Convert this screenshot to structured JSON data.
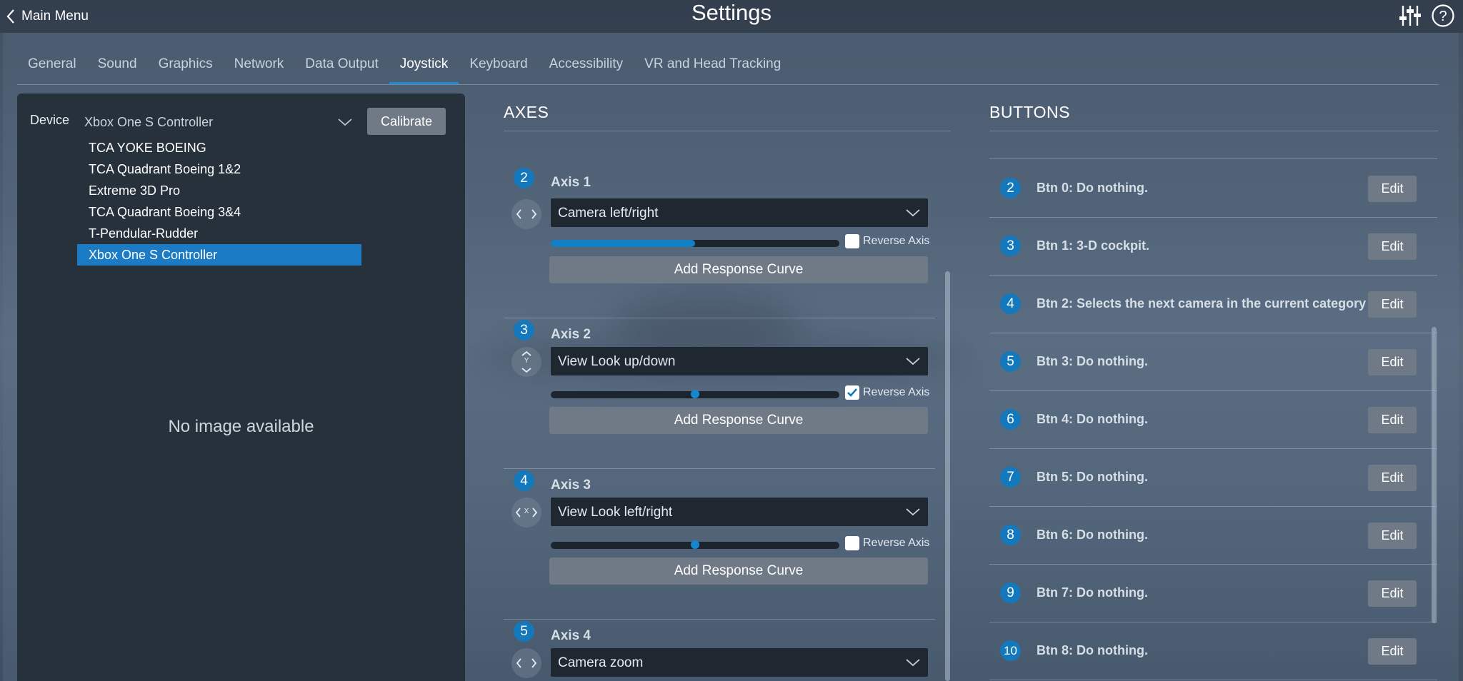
{
  "header": {
    "back_label": "Main Menu",
    "title": "Settings"
  },
  "tabs": [
    {
      "label": "General"
    },
    {
      "label": "Sound"
    },
    {
      "label": "Graphics"
    },
    {
      "label": "Network"
    },
    {
      "label": "Data Output"
    },
    {
      "label": "Joystick",
      "active": true
    },
    {
      "label": "Keyboard"
    },
    {
      "label": "Accessibility"
    },
    {
      "label": "VR and Head Tracking"
    }
  ],
  "device": {
    "label": "Device",
    "selected": "Xbox One S Controller",
    "calibrate_label": "Calibrate",
    "options": [
      "TCA YOKE BOEING",
      "TCA Quadrant Boeing 1&2",
      "Extreme 3D Pro",
      "TCA Quadrant Boeing 3&4",
      "T-Pendular-Rudder",
      "Xbox One S Controller"
    ],
    "no_image": "No image available"
  },
  "axes": {
    "heading": "AXES",
    "items": [
      {
        "num": "2",
        "name": "Axis 1",
        "assignment": "Camera left/right",
        "reverse_label": "Reverse Axis",
        "reversed": false,
        "value": 0.5,
        "curve_label": "Add Response Curve",
        "control": "left-right"
      },
      {
        "num": "3",
        "name": "Axis 2",
        "assignment": "View Look up/down",
        "reverse_label": "Reverse Axis",
        "reversed": true,
        "value": 0.5,
        "curve_label": "Add Response Curve",
        "control": "up-down",
        "control_letter": "Y"
      },
      {
        "num": "4",
        "name": "Axis 3",
        "assignment": "View Look left/right",
        "reverse_label": "Reverse Axis",
        "reversed": false,
        "value": 0.5,
        "curve_label": "Add Response Curve",
        "control": "left-right",
        "control_letter": "X"
      },
      {
        "num": "5",
        "name": "Axis 4",
        "assignment": "Camera zoom",
        "control": "left-right"
      }
    ]
  },
  "buttons": {
    "heading": "BUTTONS",
    "edit_label": "Edit",
    "items": [
      {
        "num": "2",
        "label": "Btn 0: Do nothing."
      },
      {
        "num": "3",
        "label": "Btn 1: 3-D cockpit."
      },
      {
        "num": "4",
        "label": "Btn 2: Selects the next camera in the current category"
      },
      {
        "num": "5",
        "label": "Btn 3: Do nothing."
      },
      {
        "num": "6",
        "label": "Btn 4: Do nothing."
      },
      {
        "num": "7",
        "label": "Btn 5: Do nothing."
      },
      {
        "num": "8",
        "label": "Btn 6: Do nothing."
      },
      {
        "num": "9",
        "label": "Btn 7: Do nothing."
      },
      {
        "num": "10",
        "label": "Btn 8: Do nothing."
      }
    ]
  }
}
